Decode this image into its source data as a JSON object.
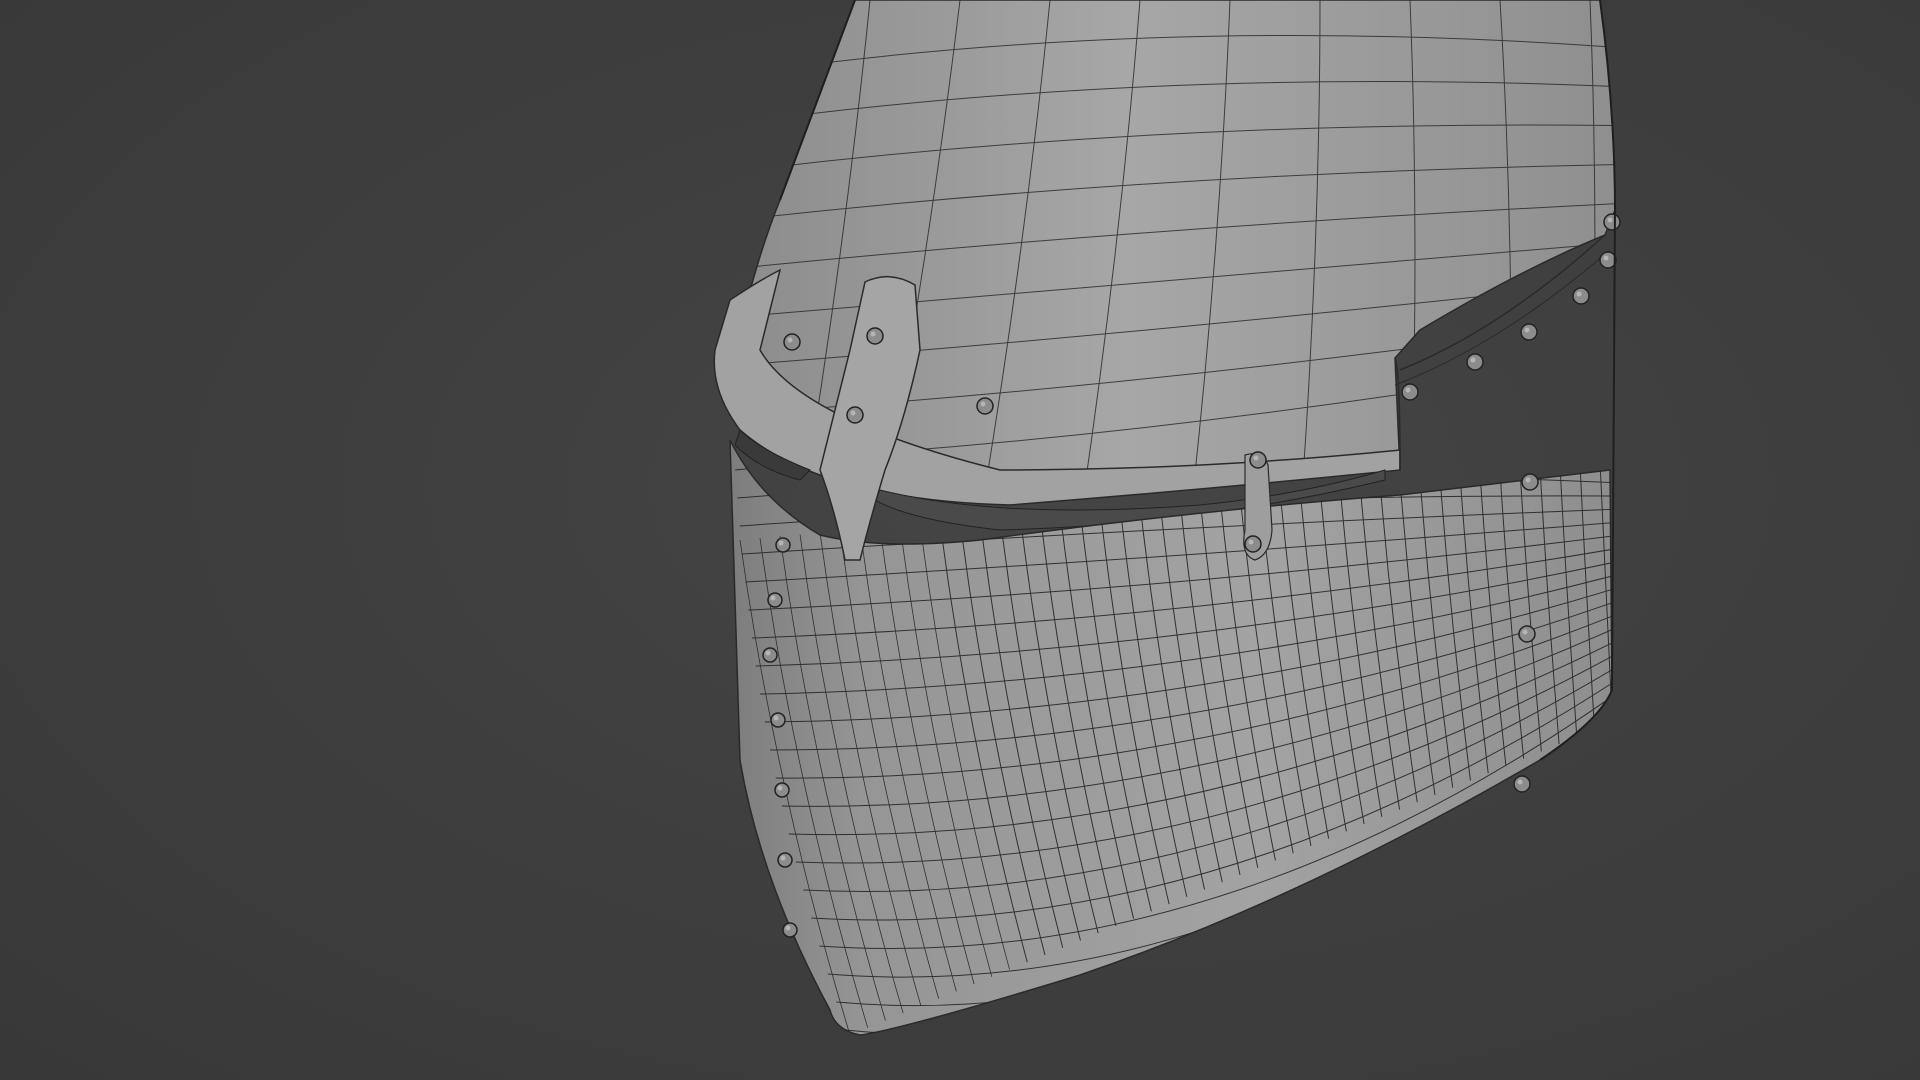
{
  "scene": {
    "background_color": "#3d3d3d",
    "object": "great-helm-wireframe",
    "shading": "solid",
    "overlay": "wireframe",
    "mesh_color": "#9a9a9a",
    "wire_color": "#262626",
    "rivet_color": "#8a8a8a"
  }
}
